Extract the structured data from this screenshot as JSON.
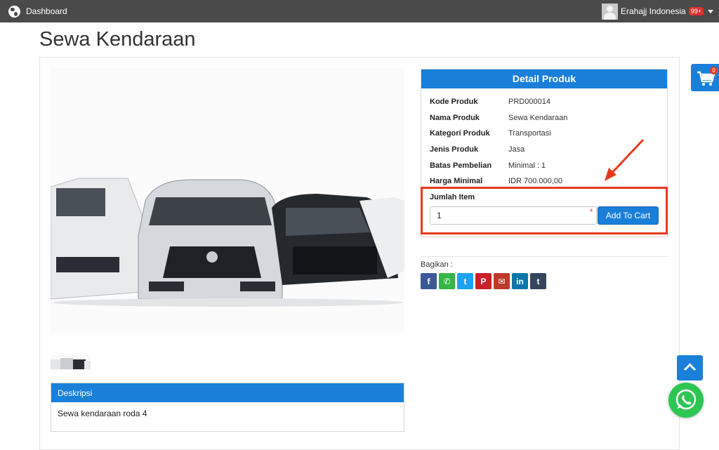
{
  "topbar": {
    "brand_label": "Dashboard",
    "user_name": "Erahajj Indonesia",
    "notif_count": "99+"
  },
  "page": {
    "title": "Sewa Kendaraan"
  },
  "detail": {
    "header": "Detail Produk",
    "rows": [
      {
        "label": "Kode Produk",
        "value": "PRD000014"
      },
      {
        "label": "Nama Produk",
        "value": "Sewa Kendaraan"
      },
      {
        "label": "Kategori Produk",
        "value": "Transportasi"
      },
      {
        "label": "Jenis Produk",
        "value": "Jasa"
      },
      {
        "label": "Batas Pembelian",
        "value": "Minimal : 1"
      },
      {
        "label": "Harga Minimal",
        "value": "IDR 700.000,00"
      }
    ]
  },
  "order": {
    "qty_label": "Jumlah Item",
    "qty_value": "1",
    "required_mark": "*",
    "add_to_cart_label": "Add To Cart"
  },
  "share": {
    "label": "Bagikan :",
    "buttons": [
      {
        "name": "facebook",
        "glyph": "f",
        "color": "#3b5998"
      },
      {
        "name": "whatsapp",
        "glyph": "✆",
        "color": "#34b545"
      },
      {
        "name": "twitter",
        "glyph": "t",
        "color": "#1da1f2"
      },
      {
        "name": "pinterest",
        "glyph": "P",
        "color": "#cb2027"
      },
      {
        "name": "email",
        "glyph": "✉",
        "color": "#c0392b"
      },
      {
        "name": "linkedin",
        "glyph": "in",
        "color": "#0e76a8"
      },
      {
        "name": "tumblr",
        "glyph": "t",
        "color": "#35465c"
      }
    ]
  },
  "description": {
    "header": "Deskripsi",
    "body": "Sewa kendaraan roda 4"
  },
  "cart": {
    "count": "0"
  },
  "colors": {
    "primary": "#1a7fd9",
    "highlight": "#e8391d",
    "topbar": "#4a4a4a"
  }
}
